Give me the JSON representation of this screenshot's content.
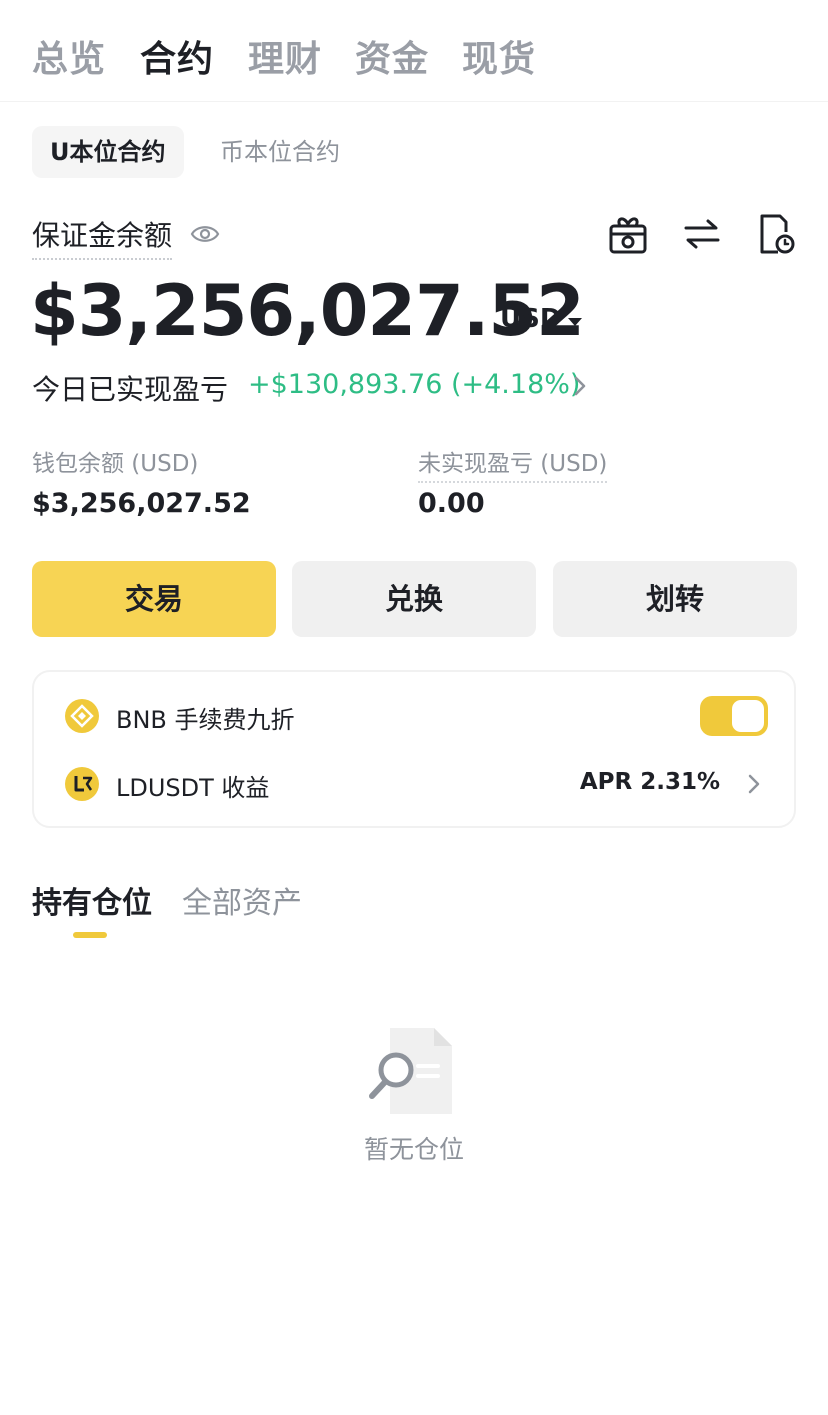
{
  "top_tabs": [
    "总览",
    "合约",
    "理财",
    "资金",
    "现货"
  ],
  "sub_tabs": [
    "U本位合约",
    "币本位合约"
  ],
  "margin": {
    "label": "保证金余额",
    "balance": "$3,256,027.52",
    "currency": "USD"
  },
  "header_icons": [
    "gift-camera-icon",
    "swap-arrows-icon",
    "document-clock-icon"
  ],
  "today_pnl": {
    "label": "今日已实现盈亏",
    "value": "+$130,893.76 (+4.18%)",
    "color": "#2ebd85"
  },
  "wallet": {
    "label": "钱包余额 (USD)",
    "value": "$3,256,027.52"
  },
  "unrealized": {
    "label": "未实现盈亏 (USD)",
    "value": "0.00"
  },
  "actions": {
    "trade": "交易",
    "convert": "兑换",
    "transfer": "划转"
  },
  "bnb_row": {
    "label": "BNB 手续费九折",
    "toggle_on": true
  },
  "ldusdt_row": {
    "label": "LDUSDT 收益",
    "apr": "APR 2.31%"
  },
  "position_tabs": {
    "holdings": "持有仓位",
    "all_assets": "全部资产"
  },
  "empty_state": {
    "text": "暂无仓位"
  },
  "colors": {
    "accent": "#f0c93b",
    "primary_button": "#f7d454",
    "profit": "#2ebd85",
    "muted": "#8e939b"
  }
}
